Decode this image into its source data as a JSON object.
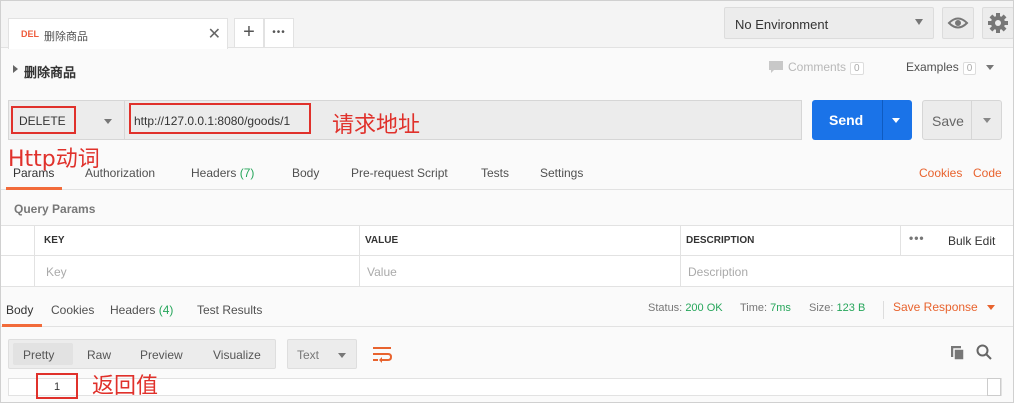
{
  "tab": {
    "method": "DEL",
    "name": "删除商品",
    "close": "✕"
  },
  "tabbar": {
    "new_tab": "+",
    "more": "•••"
  },
  "environment": {
    "selected": "No Environment"
  },
  "request": {
    "name": "删除商品",
    "comments_label": "Comments",
    "comments_count": "0",
    "examples_label": "Examples",
    "examples_count": "0",
    "method": "DELETE",
    "url": "http://127.0.0.1:8080/goods/1",
    "send_label": "Send",
    "save_label": "Save"
  },
  "annotations": {
    "url": "请求地址",
    "verb": "Http动词",
    "response": "返回值"
  },
  "request_tabs": {
    "params": "Params",
    "authorization": "Authorization",
    "headers": "Headers",
    "headers_count": "(7)",
    "body": "Body",
    "prerequest": "Pre-request Script",
    "tests": "Tests",
    "settings": "Settings",
    "cookies": "Cookies",
    "code": "Code"
  },
  "query_params": {
    "title": "Query Params",
    "columns": [
      "KEY",
      "VALUE",
      "DESCRIPTION"
    ],
    "placeholders": [
      "Key",
      "Value",
      "Description"
    ],
    "more": "•••",
    "bulk_edit": "Bulk Edit"
  },
  "response_tabs": {
    "body": "Body",
    "cookies": "Cookies",
    "headers": "Headers",
    "headers_count": "(4)",
    "test_results": "Test Results",
    "status_label": "Status:",
    "status_value": "200 OK",
    "time_label": "Time:",
    "time_value": "7ms",
    "size_label": "Size:",
    "size_value": "123 B",
    "save_response": "Save Response"
  },
  "body_view": {
    "modes": [
      "Pretty",
      "Raw",
      "Preview",
      "Visualize"
    ],
    "format": "Text",
    "line_number": "1"
  },
  "colors": {
    "accent": "#f26b3a",
    "send": "#1a73e8",
    "annotation": "#e0312b",
    "success": "#26a65b"
  }
}
